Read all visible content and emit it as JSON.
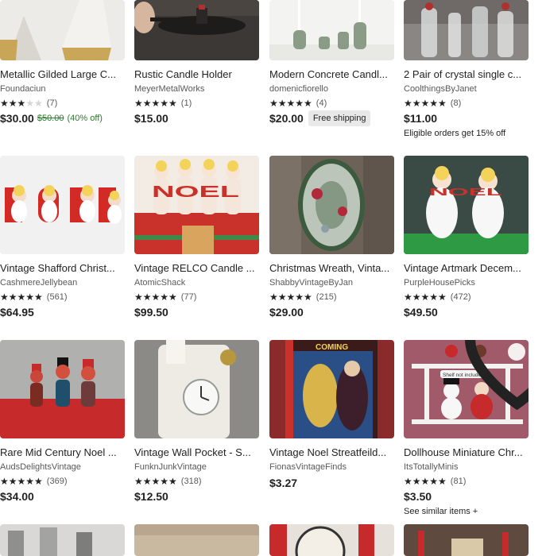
{
  "listings": [
    {
      "title": "Metallic Gilded Large C...",
      "shop": "Foundaciun",
      "stars": 3,
      "count": "(7)",
      "price": "$30.00",
      "original_price": "$50.00",
      "discount": "(40% off)",
      "badge": "",
      "note": ""
    },
    {
      "title": "Rustic Candle Holder",
      "shop": "MeyerMetalWorks",
      "stars": 5,
      "count": "(1)",
      "price": "$15.00",
      "original_price": "",
      "discount": "",
      "badge": "",
      "note": ""
    },
    {
      "title": "Modern Concrete Candl...",
      "shop": "domenicfiorello",
      "stars": 5,
      "count": "(4)",
      "price": "$20.00",
      "original_price": "",
      "discount": "",
      "badge": "Free shipping",
      "note": ""
    },
    {
      "title": "2 Pair of crystal single c...",
      "shop": "CoolthingsByJanet",
      "stars": 5,
      "count": "(8)",
      "price": "$11.00",
      "original_price": "",
      "discount": "",
      "badge": "",
      "note": "Eligible orders get 15% off"
    },
    {
      "title": "Vintage Shafford Christ...",
      "shop": "CashmereJellybean",
      "stars": 5,
      "count": "(561)",
      "price": "$64.95",
      "original_price": "",
      "discount": "",
      "badge": "",
      "note": ""
    },
    {
      "title": "Vintage RELCO Candle ...",
      "shop": "AtomicShack",
      "stars": 5,
      "count": "(77)",
      "price": "$99.50",
      "original_price": "",
      "discount": "",
      "badge": "",
      "note": ""
    },
    {
      "title": "Christmas Wreath, Vinta...",
      "shop": "ShabbyVintageByJan",
      "stars": 5,
      "count": "(215)",
      "price": "$29.00",
      "original_price": "",
      "discount": "",
      "badge": "",
      "note": ""
    },
    {
      "title": "Vintage Artmark Decem...",
      "shop": "PurpleHousePicks",
      "stars": 5,
      "count": "(472)",
      "price": "$49.50",
      "original_price": "",
      "discount": "",
      "badge": "",
      "note": ""
    },
    {
      "title": "Rare Mid Century Noel ...",
      "shop": "AudsDelightsVintage",
      "stars": 5,
      "count": "(369)",
      "price": "$34.00",
      "original_price": "",
      "discount": "",
      "badge": "",
      "note": ""
    },
    {
      "title": "Vintage Wall Pocket - S...",
      "shop": "FunknJunkVintage",
      "stars": 5,
      "count": "(318)",
      "price": "$12.50",
      "original_price": "",
      "discount": "",
      "badge": "",
      "note": ""
    },
    {
      "title": "Vintage Noel Streatfeild...",
      "shop": "FionasVintageFinds",
      "stars": 0,
      "count": "",
      "price": "$3.27",
      "original_price": "",
      "discount": "",
      "badge": "",
      "note": ""
    },
    {
      "title": "Dollhouse Miniature Chr...",
      "shop": "ItsTotallyMinis",
      "stars": 5,
      "count": "(81)",
      "price": "$3.50",
      "original_price": "",
      "discount": "",
      "badge": "",
      "note": "See similar items +"
    }
  ],
  "image_texts": {
    "relco_noel": "NOEL",
    "artmark_noel": "NOEL",
    "book_coming": "COMING",
    "dollhouse_tag": "Shelf not included"
  },
  "icons": {
    "favorite": "heart-icon",
    "star": "star-icon"
  },
  "colors": {
    "sale_green": "#2d7a2d",
    "badge_bg": "#e9e9e9",
    "muted_text": "#595959"
  }
}
